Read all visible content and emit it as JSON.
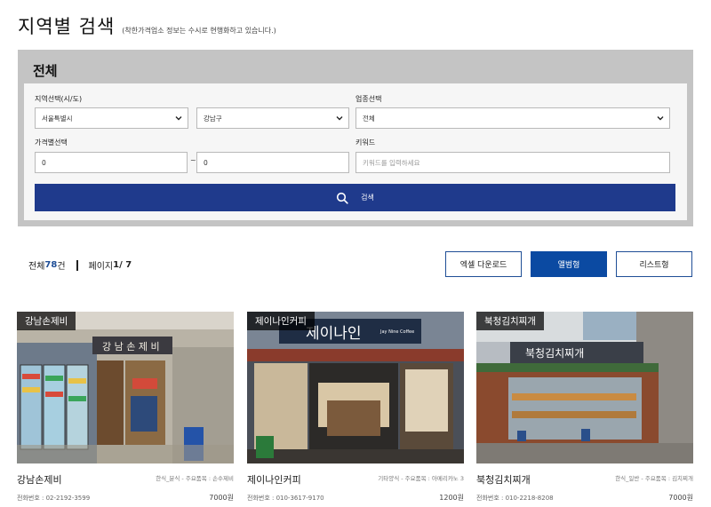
{
  "header": {
    "title": "지역별 검색",
    "subtitle": "(착한가격업소 정보는 수시로 현행화하고 있습니다.)"
  },
  "search": {
    "panel_title": "전체",
    "region_label": "지역선택(시/도)",
    "city_value": "서울특별시",
    "district_value": "강남구",
    "industry_label": "업종선택",
    "industry_value": "전체",
    "price_label": "가격별선택",
    "price_min": "0",
    "price_sep": "~",
    "price_max": "0",
    "keyword_label": "키워드",
    "keyword_placeholder": "키워드를 입력하세요",
    "button_label": "검색"
  },
  "summary": {
    "total_prefix": "전체 ",
    "total_count": "78",
    "total_suffix": "건",
    "page_prefix": "페이지 ",
    "page_current": "1",
    "page_rest": "/ 7"
  },
  "view_buttons": {
    "excel": "엑셀 다운로드",
    "album": "앨범형",
    "list": "리스트형"
  },
  "cards": [
    {
      "tag": "강남손제비",
      "name": "강남손제비",
      "category": "한식_분식 - 주요품목 : 손수제비",
      "phone": "전화번호 : 02-2192-3599",
      "price": "7000원",
      "sign_text": "강 남 손 제 비"
    },
    {
      "tag": "제이나인커피",
      "name": "제이나인커피",
      "category": "기타양식 - 주요품목 : 아메리카노 3",
      "phone": "전화번호 : 010-3617-9170",
      "price": "1200원",
      "sign_text": "제이나인",
      "sign_sub": "Jay Nine Coffee"
    },
    {
      "tag": "북청김치찌개",
      "name": "북청김치찌개",
      "category": "한식_일반 - 주요품목 : 김치찌개",
      "phone": "전화번호 : 010-2218-8208",
      "price": "7000원",
      "sign_text": "북청김치찌개"
    }
  ],
  "colors": {
    "primary": "#1f3a8c",
    "accent": "#0b4aa2",
    "panel_bg": "#c4c4c4",
    "count_color": "#1f4e96"
  }
}
